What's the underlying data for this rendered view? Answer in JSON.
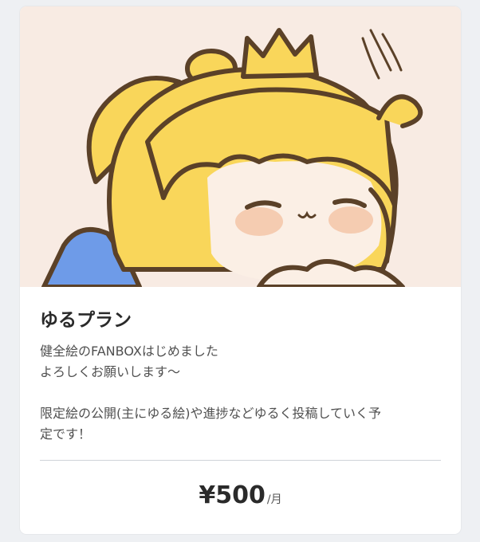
{
  "plan": {
    "title": "ゆるプラン",
    "description": "健全絵のFANBOXはじめました\nよろしくお願いします〜\n\n限定絵の公開(主にゆる絵)や進捗などゆるく投稿していく予\n定です！",
    "price": "¥500",
    "price_unit": "/月"
  },
  "colors": {
    "card_bg": "#ffffff",
    "art_bg": "#f8ebe3",
    "hair": "#f9d65a",
    "outline": "#5b4128",
    "blue": "#6e9be8"
  }
}
